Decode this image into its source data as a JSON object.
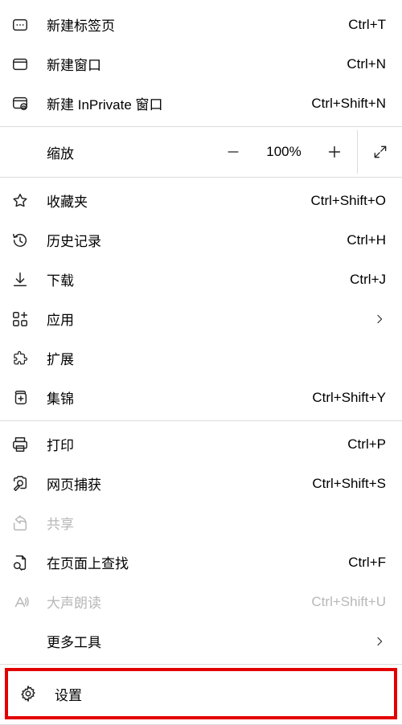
{
  "menu": {
    "new_tab": {
      "label": "新建标签页",
      "shortcut": "Ctrl+T"
    },
    "new_window": {
      "label": "新建窗口",
      "shortcut": "Ctrl+N"
    },
    "new_inprivate": {
      "label": "新建 InPrivate 窗口",
      "shortcut": "Ctrl+Shift+N"
    },
    "zoom": {
      "label": "缩放",
      "value": "100%"
    },
    "favorites": {
      "label": "收藏夹",
      "shortcut": "Ctrl+Shift+O"
    },
    "history": {
      "label": "历史记录",
      "shortcut": "Ctrl+H"
    },
    "downloads": {
      "label": "下载",
      "shortcut": "Ctrl+J"
    },
    "apps": {
      "label": "应用"
    },
    "extensions": {
      "label": "扩展"
    },
    "collections": {
      "label": "集锦",
      "shortcut": "Ctrl+Shift+Y"
    },
    "print": {
      "label": "打印",
      "shortcut": "Ctrl+P"
    },
    "web_capture": {
      "label": "网页捕获",
      "shortcut": "Ctrl+Shift+S"
    },
    "share": {
      "label": "共享"
    },
    "find": {
      "label": "在页面上查找",
      "shortcut": "Ctrl+F"
    },
    "read_aloud": {
      "label": "大声朗读",
      "shortcut": "Ctrl+Shift+U"
    },
    "more_tools": {
      "label": "更多工具"
    },
    "settings": {
      "label": "设置"
    }
  }
}
